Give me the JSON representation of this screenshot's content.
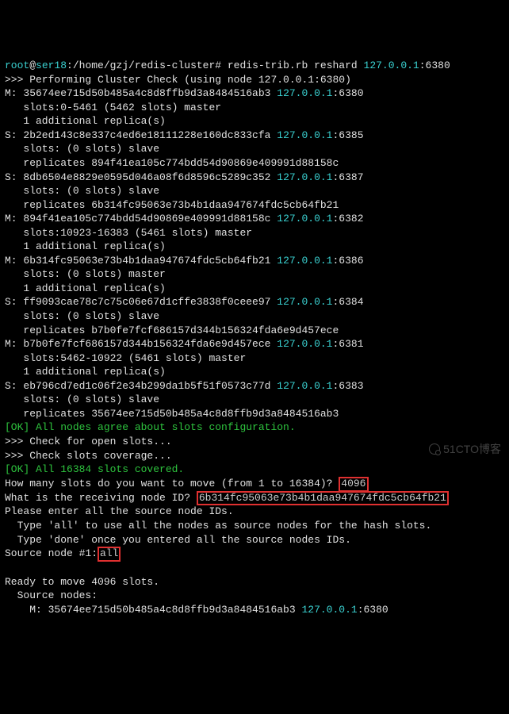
{
  "prompt": {
    "user": "root",
    "host": "ser18",
    "path": ":/home/gzj/redis-cluster",
    "plain": "# redis-trib.rb reshard ",
    "ip": "127.0.0.1",
    "port": ":6380"
  },
  "header": ">>> Performing Cluster Check (using node 127.0.0.1:6380)",
  "nodes": [
    {
      "r": "M",
      "id": "35674ee715d50b485a4c8d8ffb9d3a8484516ab3",
      "ip": "127.0.0.1",
      "port": ":6380",
      "slots": "   slots:0-5461 (5462 slots) master",
      "extra": "   1 additional replica(s)"
    },
    {
      "r": "S",
      "id": "2b2ed143c8e337c4ed6e18111228e160dc833cfa",
      "ip": "127.0.0.1",
      "port": ":6385",
      "slots": "   slots: (0 slots) slave",
      "extra": "   replicates 894f41ea105c774bdd54d90869e409991d88158c"
    },
    {
      "r": "S",
      "id": "8db6504e8829e0595d046a08f6d8596c5289c352",
      "ip": "127.0.0.1",
      "port": ":6387",
      "slots": "   slots: (0 slots) slave",
      "extra": "   replicates 6b314fc95063e73b4b1daa947674fdc5cb64fb21"
    },
    {
      "r": "M",
      "id": "894f41ea105c774bdd54d90869e409991d88158c",
      "ip": "127.0.0.1",
      "port": ":6382",
      "slots": "   slots:10923-16383 (5461 slots) master",
      "extra": "   1 additional replica(s)"
    },
    {
      "r": "M",
      "id": "6b314fc95063e73b4b1daa947674fdc5cb64fb21",
      "ip": "127.0.0.1",
      "port": ":6386",
      "slots": "   slots: (0 slots) master",
      "extra": "   1 additional replica(s)"
    },
    {
      "r": "S",
      "id": "ff9093cae78c7c75c06e67d1cffe3838f0ceee97",
      "ip": "127.0.0.1",
      "port": ":6384",
      "slots": "   slots: (0 slots) slave",
      "extra": "   replicates b7b0fe7fcf686157d344b156324fda6e9d457ece"
    },
    {
      "r": "M",
      "id": "b7b0fe7fcf686157d344b156324fda6e9d457ece",
      "ip": "127.0.0.1",
      "port": ":6381",
      "slots": "   slots:5462-10922 (5461 slots) master",
      "extra": "   1 additional replica(s)"
    },
    {
      "r": "S",
      "id": "eb796cd7ed1c06f2e34b299da1b5f51f0573c77d",
      "ip": "127.0.0.1",
      "port": ":6383",
      "slots": "   slots: (0 slots) slave",
      "extra": "   replicates 35674ee715d50b485a4c8d8ffb9d3a8484516ab3"
    }
  ],
  "ok1": "[OK] All nodes agree about slots configuration.",
  "check1": ">>> Check for open slots...",
  "check2": ">>> Check slots coverage...",
  "ok2": "[OK] All 16384 slots covered.",
  "q1a": "How many slots do you want to move (from 1 to 16384)? ",
  "q1b": "4096",
  "q2a": "What is the receiving node ID? ",
  "q2b": "6b314fc95063e73b4b1daa947674fdc5cb64fb21",
  "srcIntro": "Please enter all the source node IDs.",
  "srcHint1": "  Type 'all' to use all the nodes as source nodes for the hash slots.",
  "srcHint2": "  Type 'done' once you entered all the source nodes IDs.",
  "srcPromptA": "Source node #1:",
  "srcPromptB": "all",
  "blank": " ",
  "ready": "Ready to move 4096 slots.",
  "srcNodes": "  Source nodes:",
  "footA": "    M: 35674ee715d50b485a4c8d8ffb9d3a8484516ab3 ",
  "footIp": "127.0.0.1",
  "footPort": ":6380",
  "watermark": "51CTO博客"
}
